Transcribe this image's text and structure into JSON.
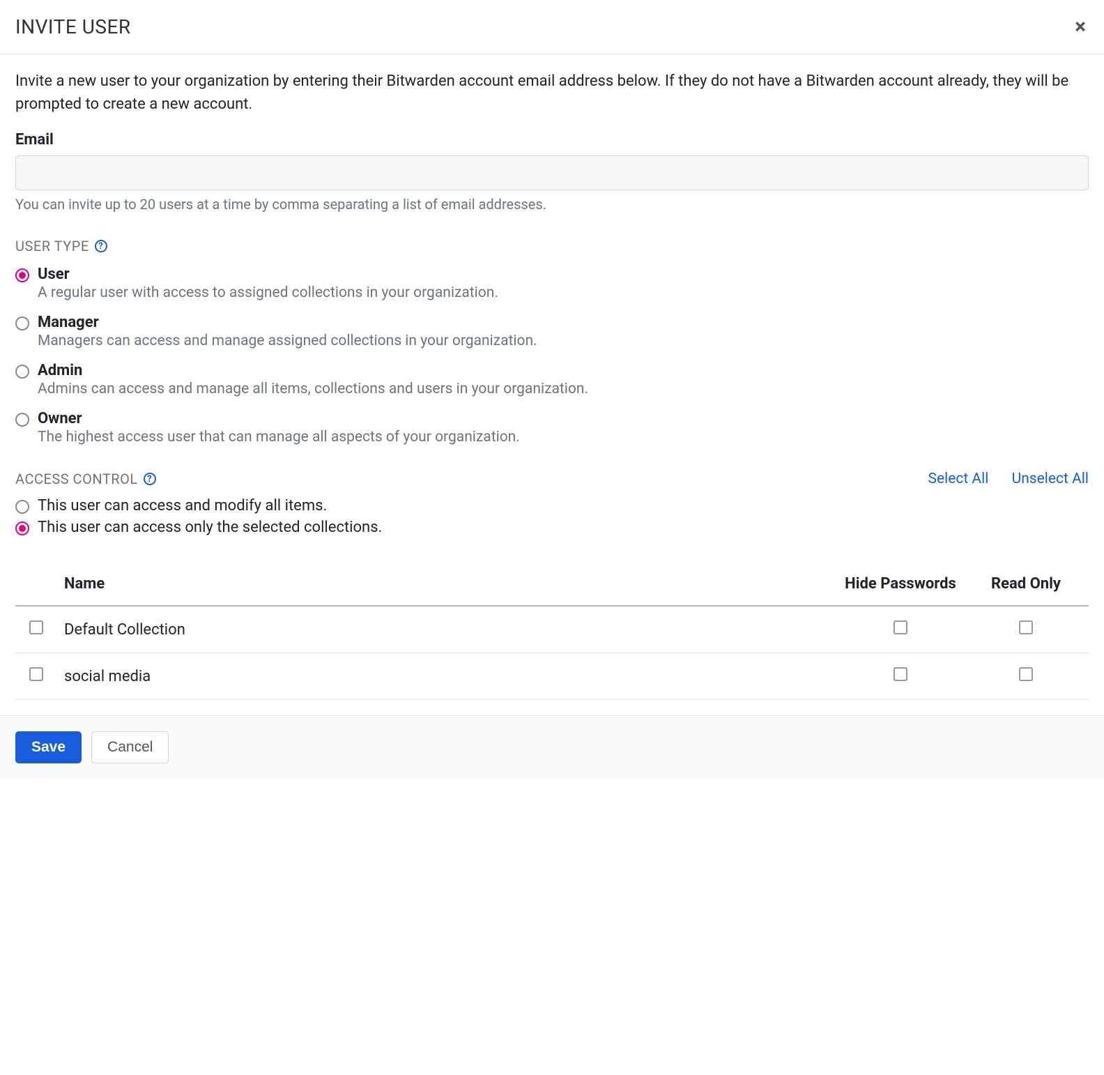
{
  "header": {
    "title": "INVITE USER"
  },
  "intro": "Invite a new user to your organization by entering their Bitwarden account email address below. If they do not have a Bitwarden account already, they will be prompted to create a new account.",
  "email": {
    "label": "Email",
    "value": "",
    "hint": "You can invite up to 20 users at a time by comma separating a list of email addresses."
  },
  "userType": {
    "heading": "USER TYPE",
    "options": [
      {
        "title": "User",
        "desc": "A regular user with access to assigned collections in your organization.",
        "selected": true
      },
      {
        "title": "Manager",
        "desc": "Managers can access and manage assigned collections in your organization.",
        "selected": false
      },
      {
        "title": "Admin",
        "desc": "Admins can access and manage all items, collections and users in your organization.",
        "selected": false
      },
      {
        "title": "Owner",
        "desc": "The highest access user that can manage all aspects of your organization.",
        "selected": false
      }
    ]
  },
  "accessControl": {
    "heading": "ACCESS CONTROL",
    "selectAll": "Select All",
    "unselectAll": "Unselect All",
    "options": [
      {
        "label": "This user can access and modify all items.",
        "selected": false
      },
      {
        "label": "This user can access only the selected collections.",
        "selected": true
      }
    ],
    "table": {
      "headers": {
        "name": "Name",
        "hidePasswords": "Hide Passwords",
        "readOnly": "Read Only"
      },
      "rows": [
        {
          "name": "Default Collection",
          "checked": false,
          "hidePasswords": false,
          "readOnly": false
        },
        {
          "name": "social media",
          "checked": false,
          "hidePasswords": false,
          "readOnly": false
        }
      ]
    }
  },
  "footer": {
    "save": "Save",
    "cancel": "Cancel"
  }
}
